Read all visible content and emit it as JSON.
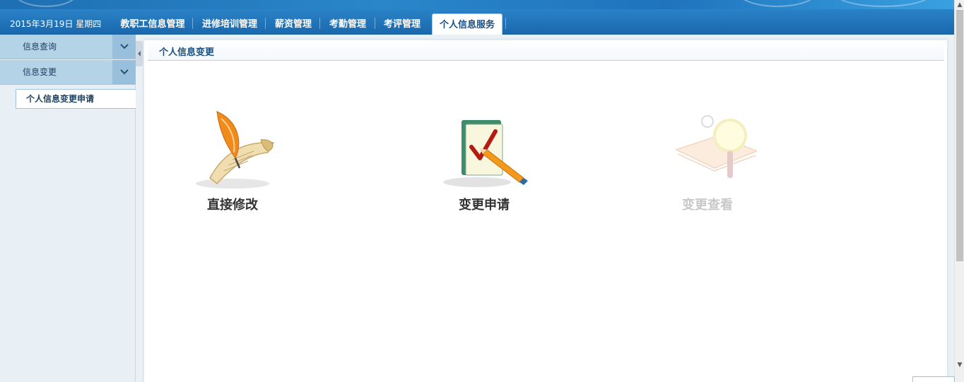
{
  "header": {
    "date": "2015年3月19日 星期四",
    "tabs": [
      {
        "label": "教职工信息管理",
        "active": false
      },
      {
        "label": "进修培训管理",
        "active": false
      },
      {
        "label": "薪资管理",
        "active": false
      },
      {
        "label": "考勤管理",
        "active": false
      },
      {
        "label": "考评管理",
        "active": false
      },
      {
        "label": "个人信息服务",
        "active": true
      }
    ]
  },
  "sidebar": {
    "groups": [
      {
        "label": "信息查询",
        "icon": "chevron-down-icon"
      },
      {
        "label": "信息变更",
        "icon": "chevron-down-icon"
      }
    ],
    "items": [
      {
        "label": "个人信息变更申请",
        "selected": true
      }
    ]
  },
  "main": {
    "panel_title": "个人信息变更",
    "actions": [
      {
        "label": "直接修改",
        "icon": "quill-scroll-icon",
        "enabled": true
      },
      {
        "label": "变更申请",
        "icon": "checkmark-pencil-icon",
        "enabled": true
      },
      {
        "label": "变更查看",
        "icon": "notebook-magnifier-icon",
        "enabled": false
      }
    ]
  },
  "colors": {
    "navbar": "#1f74bd",
    "sidebar_group": "#b5d3e7",
    "title_text": "#1a4f80"
  }
}
